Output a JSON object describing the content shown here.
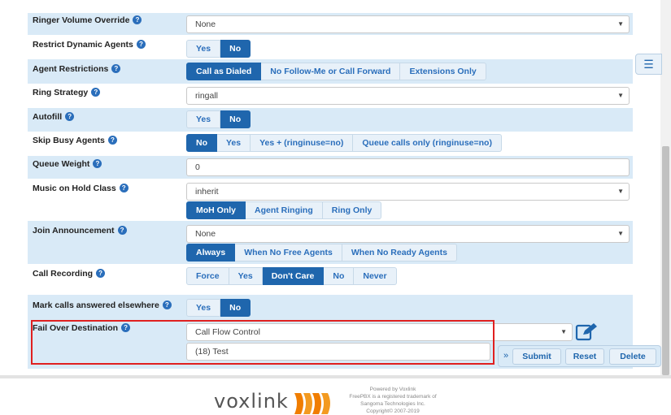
{
  "rows": {
    "ringer_volume": {
      "label": "Ringer Volume Override",
      "value": "None"
    },
    "restrict_agents": {
      "label": "Restrict Dynamic Agents",
      "options": [
        "Yes",
        "No"
      ],
      "selected": "No"
    },
    "agent_restrictions": {
      "label": "Agent Restrictions",
      "options": [
        "Call as Dialed",
        "No Follow-Me or Call Forward",
        "Extensions Only"
      ],
      "selected": "Call as Dialed"
    },
    "ring_strategy": {
      "label": "Ring Strategy",
      "value": "ringall"
    },
    "autofill": {
      "label": "Autofill",
      "options": [
        "Yes",
        "No"
      ],
      "selected": "No"
    },
    "skip_busy": {
      "label": "Skip Busy Agents",
      "options": [
        "No",
        "Yes",
        "Yes + (ringinuse=no)",
        "Queue calls only (ringinuse=no)"
      ],
      "selected": "No"
    },
    "queue_weight": {
      "label": "Queue Weight",
      "value": "0"
    },
    "moh_class": {
      "label": "Music on Hold Class",
      "value": "inherit",
      "options": [
        "MoH Only",
        "Agent Ringing",
        "Ring Only"
      ],
      "selected": "MoH Only"
    },
    "join_announcement": {
      "label": "Join Announcement",
      "value": "None",
      "options": [
        "Always",
        "When No Free Agents",
        "When No Ready Agents"
      ],
      "selected": "Always"
    },
    "call_recording": {
      "label": "Call Recording",
      "options": [
        "Force",
        "Yes",
        "Don't Care",
        "No",
        "Never"
      ],
      "selected": "Don't Care"
    },
    "mark_answered": {
      "label": "Mark calls answered elsewhere",
      "options": [
        "Yes",
        "No"
      ],
      "selected": "No"
    },
    "failover": {
      "label": "Fail Over Destination",
      "dropdown_items": [
        "Call Flow Control",
        "(18) Test"
      ]
    }
  },
  "actions": {
    "submit": "Submit",
    "reset": "Reset",
    "delete": "Delete",
    "chevron": "»"
  },
  "footer": {
    "logo": "voxlink",
    "powered_lines": [
      "Powered by Voxlink",
      "FreePBX is a registered trademark of",
      "Sangoma Technologies Inc.",
      "Copyright© 2007-2019"
    ]
  },
  "icons": {
    "help": "?",
    "side_toggle": "list-icon",
    "caret": "▼"
  },
  "colors": {
    "accent": "#1f66ad",
    "row_shade": "#d9eaf7",
    "highlight": "#e02020",
    "logo_orange": "#f07d00"
  }
}
